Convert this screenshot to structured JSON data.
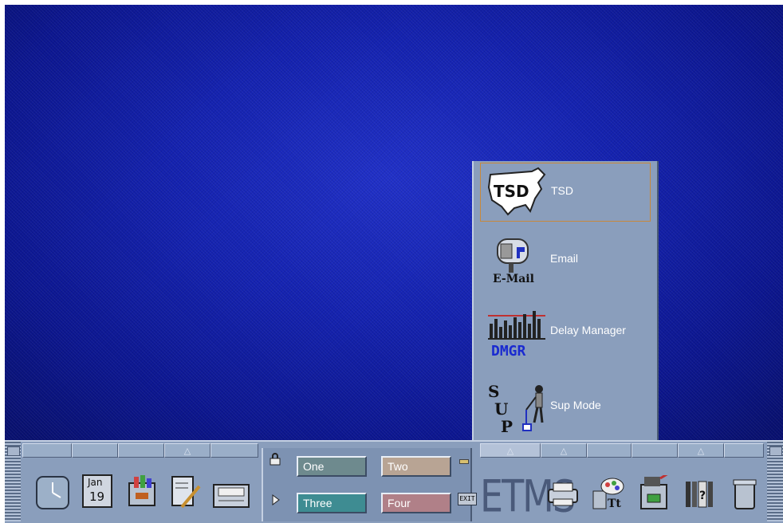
{
  "subpanel": {
    "items": [
      {
        "label": "TSD",
        "icon": "usa-map-tsd-icon",
        "icon_text": "TSD"
      },
      {
        "label": "Email",
        "icon": "mailbox-icon",
        "icon_text": "E-Mail"
      },
      {
        "label": "Delay Manager",
        "icon": "bar-chart-dmgr-icon",
        "icon_text": "DMGR"
      },
      {
        "label": "Sup Mode",
        "icon": "person-sup-icon",
        "icon_text": "SUP"
      }
    ]
  },
  "panel": {
    "calendar": {
      "month": "Jan",
      "day": "19"
    },
    "workspaces": [
      {
        "label": "One",
        "color": "#6e8a8e"
      },
      {
        "label": "Two",
        "color": "#b8a494"
      },
      {
        "label": "Three",
        "color": "#3e8c92"
      },
      {
        "label": "Four",
        "color": "#b08088"
      }
    ],
    "exit_label": "EXIT",
    "logo": "ETMS"
  },
  "colors": {
    "desktop": "#1422b0",
    "panel": "#8a9ebc"
  }
}
